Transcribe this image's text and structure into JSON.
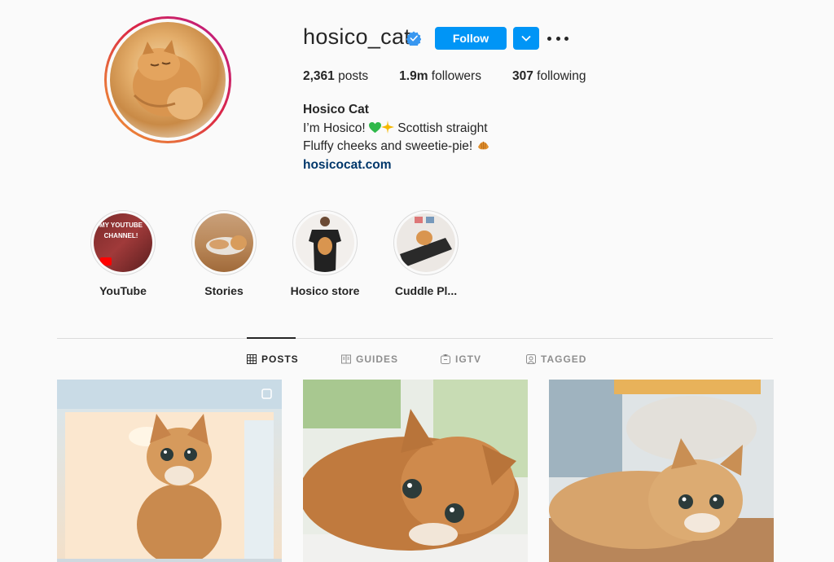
{
  "profile": {
    "username": "hosico_cat",
    "verified": true,
    "follow_label": "Follow",
    "stats": {
      "posts_count": "2,361",
      "posts_label": " posts",
      "followers_count": "1.9m",
      "followers_label": " followers",
      "following_count": "307",
      "following_label": " following"
    },
    "bio": {
      "name": "Hosico Cat",
      "line1_a": "I’m Hosico! ",
      "line1_b": " Scottish straight",
      "line2": "Fluffy cheeks and sweetie-pie! ",
      "link": "hosicocat.com"
    }
  },
  "highlights": [
    {
      "label": "YouTube",
      "badge_text": "MY YOUTUBE CHANNEL!"
    },
    {
      "label": "Stories"
    },
    {
      "label": "Hosico store"
    },
    {
      "label": "Cuddle Pl..."
    }
  ],
  "tabs": [
    {
      "label": "POSTS",
      "icon": "grid-icon",
      "active": true
    },
    {
      "label": "GUIDES",
      "icon": "guides-icon",
      "active": false
    },
    {
      "label": "IGTV",
      "icon": "igtv-icon",
      "active": false
    },
    {
      "label": "TAGGED",
      "icon": "tagged-icon",
      "active": false
    }
  ],
  "colors": {
    "follow_button": "#0095f6",
    "link": "#00376b",
    "text": "#262626",
    "muted": "#8e8e8e"
  }
}
